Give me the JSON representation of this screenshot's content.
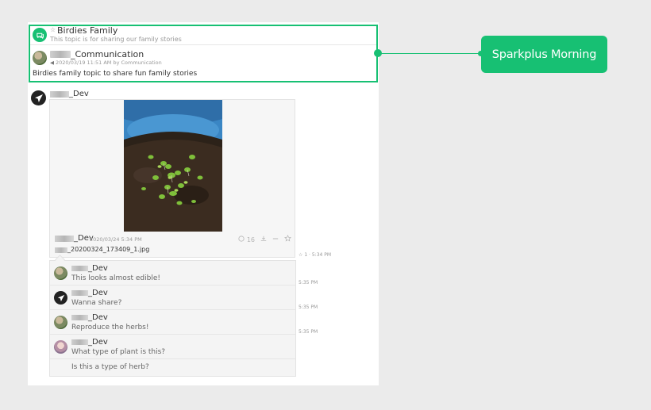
{
  "topic": {
    "title": "Birdies Family",
    "star": "☆",
    "description": "This topic is for sharing our family stories"
  },
  "announcement": {
    "author": "_Communication",
    "meta": "2020/03/19 11:51 AM by  Communication",
    "body": "Birdies family topic to share fun family stories"
  },
  "callout": {
    "label": "Sparkplus Morning"
  },
  "message": {
    "author": "_Dev",
    "file": {
      "uploader": "_Dev",
      "time": "2020/03/24 5:34 PM",
      "count": "16",
      "filename": "_20200324_173409_1.jpg",
      "side_info": "1 ·  5:34 PM"
    }
  },
  "comments": [
    {
      "author": "_Dev",
      "text": "This looks almost edible!",
      "time": "5:35 PM",
      "avatar": "plant"
    },
    {
      "author": "_Dev",
      "text": "Wanna share?",
      "time": "5:35 PM",
      "avatar": "plane"
    },
    {
      "author": "_Dev",
      "text": "Reproduce the herbs!",
      "time": "5:35 PM",
      "avatar": "plant"
    },
    {
      "author": "_Dev",
      "text": "What type of plant is this?",
      "time": "",
      "avatar": "person"
    }
  ],
  "last_comment": {
    "text": "Is this a type of herb?"
  },
  "colors": {
    "accent": "#17c073"
  }
}
